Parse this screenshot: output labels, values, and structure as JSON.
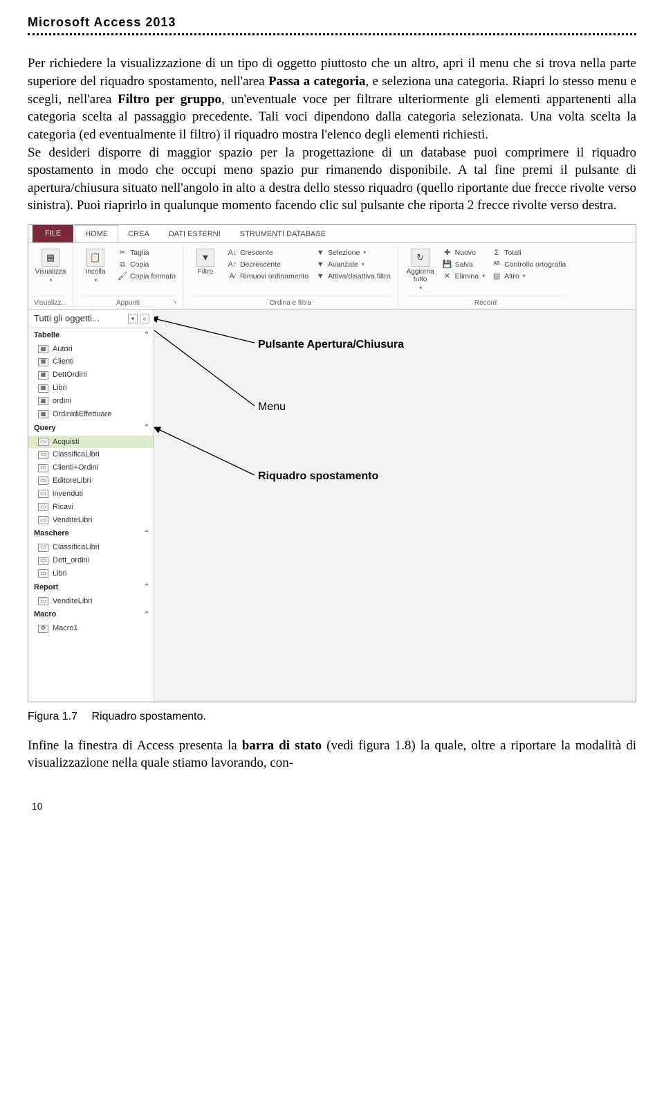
{
  "header": {
    "title": "Microsoft Access 2013"
  },
  "para1a": "Per richiedere la visualizzazione di un tipo di oggetto piuttosto che un altro, apri il menu che si trova nella parte superiore del riquadro spostamento, nell'area ",
  "para1b": "Passa a categoria",
  "para1c": ", e seleziona una categoria. Riapri lo stesso menu e scegli, nell'area ",
  "para1d": "Filtro per gruppo",
  "para1e": ", un'eventuale voce per filtrare ulteriormente gli elementi appartenenti alla categoria scelta al passaggio precedente. Tali voci dipendono dalla categoria selezionata. Una volta scelta la categoria (ed eventualmente il filtro) il riquadro mostra l'elenco degli elementi richiesti.",
  "para2": "Se desideri disporre di maggior spazio per la progettazione di un database puoi comprimere il riquadro spostamento in modo che occupi meno spazio pur rimanendo disponibile. A tal fine premi il pulsante di apertura/chiusura situato nell'angolo in alto a destra dello stesso riquadro (quello riportante due frecce rivolte verso sinistra). Puoi riaprirlo in qualunque momento facendo clic sul pulsante che riporta 2 frecce rivolte verso destra.",
  "ribbon": {
    "tabs": {
      "file": "FILE",
      "home": "HOME",
      "crea": "CREA",
      "dati": "DATI ESTERNI",
      "strum": "STRUMENTI DATABASE"
    },
    "visualizza": {
      "label": "Visualizza",
      "group": "Visualizz..."
    },
    "appunti": {
      "incolla": "Incolla",
      "taglia": "Taglia",
      "copia": "Copia",
      "copiaformato": "Copia formato",
      "group": "Appunti"
    },
    "ordina": {
      "filtro": "Filtro",
      "crescente": "Crescente",
      "decrescente": "Decrescente",
      "rimuovi": "Rimuovi ordinamento",
      "selezione": "Selezione",
      "avanzate": "Avanzate",
      "attiva": "Attiva/disattiva filtro",
      "group": "Ordina e filtra"
    },
    "record": {
      "aggiorna": "Aggiorna tutto",
      "nuovo": "Nuovo",
      "salva": "Salva",
      "elimina": "Elimina",
      "totali": "Totali",
      "ortografia": "Controllo ortografia",
      "altro": "Altro",
      "group": "Record"
    }
  },
  "navpane": {
    "title": "Tutti gli oggetti...",
    "sections": {
      "tabelle": {
        "label": "Tabelle",
        "items": [
          "Autori",
          "Clienti",
          "DettOrdini",
          "Libri",
          "ordini",
          "OrdinidiEffettuare"
        ]
      },
      "query": {
        "label": "Query",
        "items": [
          "Acquisti",
          "ClassificaLibri",
          "Clienti+Ordini",
          "EditoreLibri",
          "invenduti",
          "Ricavi",
          "VenditeLibri"
        ]
      },
      "maschere": {
        "label": "Maschere",
        "items": [
          "ClassificaLibri",
          "Dett_ordini",
          "Libri"
        ]
      },
      "report": {
        "label": "Report",
        "items": [
          "VenditeLibri"
        ]
      },
      "macro": {
        "label": "Macro",
        "items": [
          "Macro1"
        ]
      }
    }
  },
  "callouts": {
    "apertura": "Pulsante Apertura/Chiusura",
    "menu": "Menu",
    "riquadro": "Riquadro spostamento"
  },
  "caption": {
    "num": "Figura 1.7",
    "title": "Riquadro spostamento."
  },
  "para3a": "Infine la finestra di Access presenta la ",
  "para3b": "barra di stato",
  "para3c": " (vedi figura 1.8) la quale, oltre a riportare la modalità di visualizzazione nella quale stiamo lavorando, con-",
  "pagenum": "10"
}
